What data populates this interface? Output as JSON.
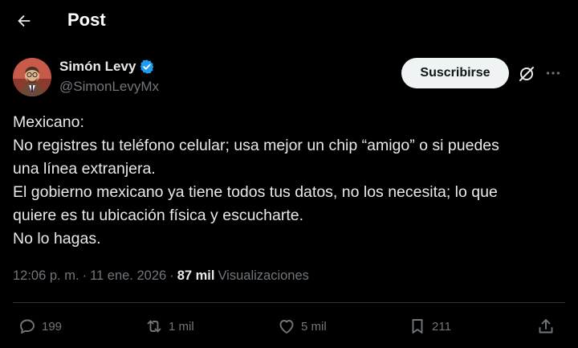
{
  "header": {
    "title": "Post"
  },
  "author": {
    "name": "Simón Levy",
    "handle": "@SimonLevyMx"
  },
  "buttons": {
    "subscribe": "Suscribirse"
  },
  "post": {
    "lines": [
      "Mexicano:",
      "No registres tu teléfono celular; usa mejor un chip “amigo” o si puedes",
      "una línea extranjera.",
      "El gobierno mexicano ya tiene todos tus datos, no los necesita; lo que",
      "quiere es tu ubicación física y escucharte.",
      "No lo hagas."
    ],
    "time": "12:06 p. m.",
    "sep": "·",
    "date": "11 ene. 2026",
    "views_count": "87 mil",
    "views_label": "Visualizaciones"
  },
  "actions": {
    "replies": "199",
    "reposts": "1 mil",
    "likes": "5 mil",
    "bookmarks": "211"
  },
  "colors": {
    "background": "#000000",
    "text": "#e7e9ea",
    "muted": "#71767b",
    "verified": "#1d9bf0",
    "button_bg": "#eff3f4"
  },
  "icons": [
    "back-arrow-icon",
    "verified-badge-icon",
    "grok-icon",
    "more-icon",
    "reply-icon",
    "repost-icon",
    "like-icon",
    "bookmark-icon",
    "share-icon"
  ]
}
